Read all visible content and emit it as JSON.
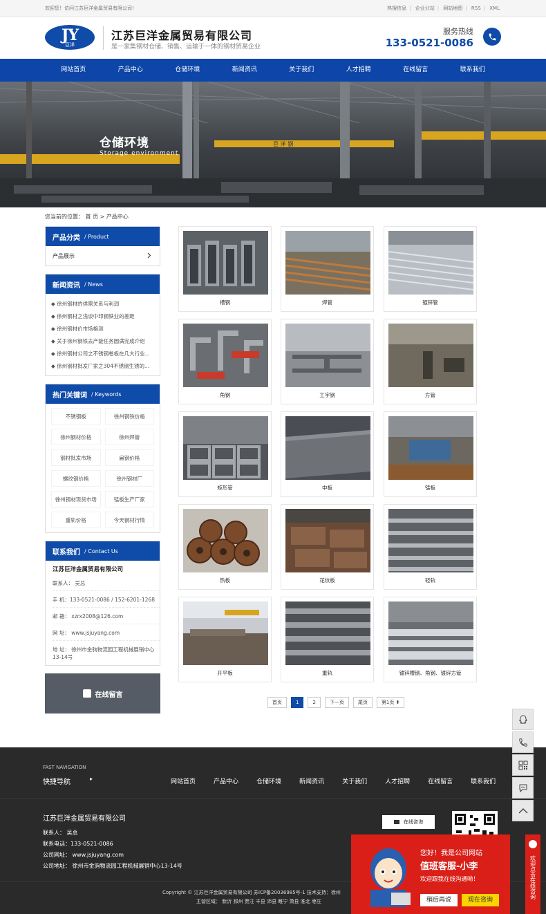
{
  "topbar": {
    "welcome": "欢迎您！访问江苏巨洋金属贸易有限公司!",
    "links": [
      "热搜信息",
      "企业分站",
      "网站地图",
      "RSS",
      "XML"
    ]
  },
  "header": {
    "logo_text": "JY",
    "logo_sub": "巨洋",
    "company_name": "江苏巨洋金属贸易有限公司",
    "slogan": "是一家集钢材仓储、销售、运输于一体的钢材贸易企业",
    "hotline_label": "服务热线",
    "hotline_number": "133-0521-0086"
  },
  "nav": [
    "网站首页",
    "产品中心",
    "仓储环境",
    "新闻资讯",
    "关于我们",
    "人才招聘",
    "在线留言",
    "联系我们"
  ],
  "banner": {
    "title": "仓储环境",
    "subtitle": "Storage environment",
    "sign_text": "巨 洋 钢"
  },
  "breadcrumb": {
    "label": "您当前的位置：",
    "home": "首 页",
    "current": "> 产品中心"
  },
  "sidebar": {
    "product": {
      "zh": "产品分类",
      "en": "/ Product",
      "item": "产品展示"
    },
    "news": {
      "zh": "新闻资讯",
      "en": "/ News",
      "items": [
        "徐州钢材的供需关系与利润",
        "徐州钢材之浅谈中印钢铁业的差距",
        "徐州钢材价市场格测",
        "关于徐州钢铁去产能任务圆满完成介绍",
        "徐州钢材公司之不锈钢卷板在几大行业...",
        "徐州钢材批发厂家之304不锈钢生锈的..."
      ]
    },
    "keywords": {
      "zh": "热门关键词",
      "en": "/ Keywords",
      "items": [
        "不锈钢板",
        "徐州钢铁价格",
        "徐州钢材价格",
        "徐州焊管",
        "钢材批发市场",
        "扁钢价格",
        "螺纹钢价格",
        "徐州钢材厂",
        "徐州钢材现货市场",
        "锰板生产厂家",
        "重轨价格",
        "今天钢材行情"
      ]
    },
    "contact": {
      "zh": "联系我们",
      "en": "/ Contact Us",
      "company": "江苏巨洋金属贸易有限公司",
      "lines": [
        "联系人： 吴总",
        "手  机：133-0521-0086 / 152-6201-1268",
        "邮  箱： xzrx2008@126.com",
        "网  址： www.jsjuyang.com",
        "地  址： 徐州市金驹物流园工程机械展销中心13-14号"
      ]
    },
    "message": "在线留言"
  },
  "products": [
    {
      "name": "槽钢",
      "icon": "channel-steel"
    },
    {
      "name": "焊管",
      "icon": "welded-pipe"
    },
    {
      "name": "镀锌管",
      "icon": "galvanized-pipe"
    },
    {
      "name": "角钢",
      "icon": "angle-steel"
    },
    {
      "name": "工字钢",
      "icon": "i-beam"
    },
    {
      "name": "方管",
      "icon": "square-tube"
    },
    {
      "name": "矩形管",
      "icon": "rectangular-tube"
    },
    {
      "name": "中板",
      "icon": "medium-plate"
    },
    {
      "name": "锰板",
      "icon": "manganese-plate"
    },
    {
      "name": "热板",
      "icon": "hot-coil"
    },
    {
      "name": "花纹板",
      "icon": "checkered-plate"
    },
    {
      "name": "轻轨",
      "icon": "light-rail"
    },
    {
      "name": "开平板",
      "icon": "leveled-plate"
    },
    {
      "name": "重轨",
      "icon": "heavy-rail"
    },
    {
      "name": "镀锌槽钢、角钢、镀锌方管",
      "icon": "galvanized-sections"
    }
  ],
  "pager": {
    "first": "首页",
    "pages": [
      "1",
      "2"
    ],
    "next": "下一页",
    "last": "尾页",
    "select": "第1页 ⬍"
  },
  "footer": {
    "nav_en": "FAST NAVIGATION",
    "nav_zh": "快捷导航",
    "nav_items": [
      "网站首页",
      "产品中心",
      "仓储环境",
      "新闻资讯",
      "关于我们",
      "人才招聘",
      "在线留言",
      "联系我们"
    ],
    "company": "江苏巨洋金属贸易有限公司",
    "contact": "联系人： 吴总",
    "phone": "联系电话：133-0521-0086",
    "site": "公司网址： www.jsjuyang.com",
    "address": "公司地址： 徐州市金驹物流园工程机械展销中心13-14号",
    "message_btn": "在线咨询",
    "copyright": "Copyright © 江苏巨洋金属贸易有限公司   苏ICP备20036985号-1   技术支持：徐州",
    "areas": "主营区域：  新沂 邳州 贾汪 丰县 沛县 睢宁 萧县 淮北 枣庄"
  },
  "chat": {
    "line1": "您好！我是公司网站",
    "line2": "值班客服-小李",
    "line3": "欢迎跟我在线沟通呦！",
    "later": "稍后再说",
    "now": "现在咨询",
    "side_tab": "欢迎点击在线咨询"
  },
  "colors": {
    "brand": "#0f4ba8",
    "nav": "#0d45a8",
    "footer": "#2a2a2a",
    "chat": "#d91f18",
    "chat_button": "#fad400"
  }
}
